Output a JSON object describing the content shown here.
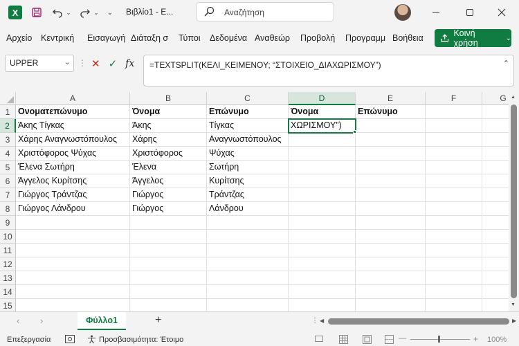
{
  "app": {
    "logo_letter": "X",
    "doc_title": "Βιβλίο1 - E...",
    "brand_color": "#107c41"
  },
  "search": {
    "placeholder": "Αναζήτηση"
  },
  "menu": {
    "items": [
      "Αρχείο",
      "Κεντρική",
      "Εισαγωγή",
      "Διάταξη σ",
      "Τύποι",
      "Δεδομένα",
      "Αναθεώρ",
      "Προβολή",
      "Προγραμμ",
      "Βοήθεια"
    ],
    "share_label": "Κοινή χρήση"
  },
  "formula_bar": {
    "name_box": "UPPER",
    "fx": "fx",
    "formula": "=TEXTSPLIT(ΚΕΛΙ_ΚΕΙΜΕΝΟΥ; “ΣΤΟΙΧΕΙΟ_ΔΙΑΧΩΡΙΣΜΟΥ”)"
  },
  "sheet": {
    "columns": [
      "A",
      "B",
      "C",
      "D",
      "E",
      "F",
      "G"
    ],
    "rows": [
      "1",
      "2",
      "3",
      "4",
      "5",
      "6",
      "7",
      "8",
      "9",
      "10",
      "11",
      "12",
      "13",
      "14",
      "15"
    ],
    "cells": [
      [
        "Ονοματεπώνυμο",
        "Όνομα",
        "Επώνυμο",
        "Όνομα",
        "Επώνυμο",
        "",
        ""
      ],
      [
        "Άκης Τίγκας",
        "Άκης",
        "Τίγκας",
        "ΧΩΡΙΣΜΟΥ”)",
        "",
        "",
        ""
      ],
      [
        "Χάρης  Αναγνωστόπουλος",
        "Χάρης",
        "Αναγνωστόπουλος",
        "",
        "",
        "",
        ""
      ],
      [
        "Χριστόφορος Ψύχας",
        "Χριστόφορος",
        "Ψύχας",
        "",
        "",
        "",
        ""
      ],
      [
        "Έλενα Σωτήρη",
        "Έλενα",
        "Σωτήρη",
        "",
        "",
        "",
        ""
      ],
      [
        "Άγγελος Κυρίτσης",
        "Άγγελος",
        "Κυρίτσης",
        "",
        "",
        "",
        ""
      ],
      [
        "Γιώργος Τράντζας",
        "Γιώργος",
        "Τράντζας",
        "",
        "",
        "",
        ""
      ],
      [
        "Γιώργος Λάνδρου",
        "Γιώργος",
        "Λάνδρου",
        "",
        "",
        "",
        ""
      ]
    ],
    "active_cell": "D2"
  },
  "tabs": {
    "sheet_name": "Φύλλο1",
    "add_label": "+"
  },
  "status": {
    "mode": "Επεξεργασία",
    "accessibility": "Προσβασιμότητα: Έτοιμο",
    "zoom": "100%"
  }
}
